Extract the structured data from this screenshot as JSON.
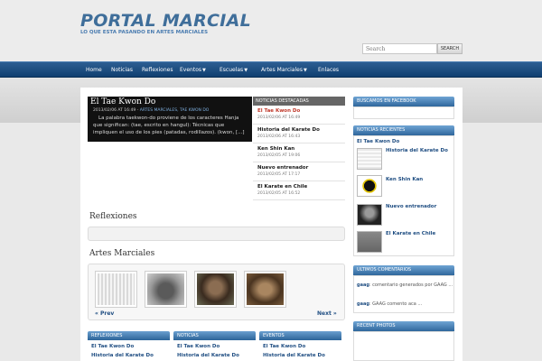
{
  "site": {
    "title": "PORTAL MARCIAL",
    "tagline": "LO QUE ESTA PASANDO EN ARTES MARCIALES"
  },
  "search": {
    "placeholder": "Search",
    "button_label": "SEARCH"
  },
  "nav": [
    {
      "label": "Home",
      "has_dropdown": false
    },
    {
      "label": "Noticias",
      "has_dropdown": false
    },
    {
      "label": "Reflexiones",
      "has_dropdown": false
    },
    {
      "label": "Eventos",
      "has_dropdown": true
    },
    {
      "label": "Escuelas",
      "has_dropdown": true
    },
    {
      "label": "Artes Marciales",
      "has_dropdown": true
    },
    {
      "label": "Enlaces",
      "has_dropdown": false
    }
  ],
  "featured": {
    "title": "El Tae Kwon Do",
    "date": "2013/02/06 AT 16:49",
    "categories": "ARTES MARCIALES, TAE KWON DO",
    "excerpt": "La palabra taekwon-do proviene de los caracteres Hanja que significan: (tae, escrito en hangul): Técnicas que impliquen el uso de los pies (patadas, rodillazos). (kwon, [...]"
  },
  "featured_list": {
    "header": "NOTICIAS DESTACADAS",
    "items": [
      {
        "title": "El Tae Kwon Do",
        "date": "2013/02/06 AT 16:49"
      },
      {
        "title": "Historia del Karate Do",
        "date": "2013/02/06 AT 16:43"
      },
      {
        "title": "Ken Shin Kan",
        "date": "2013/02/05 AT 19:06"
      },
      {
        "title": "Nuevo entrenador",
        "date": "2013/02/05 AT 17:17"
      },
      {
        "title": "El Karate en Chile",
        "date": "2013/02/05 AT 16:52"
      }
    ]
  },
  "sections": {
    "reflexiones": "Reflexiones",
    "artes_marciales": "Artes Marciales"
  },
  "carousel": {
    "prev": "« Prev",
    "next": "Next »"
  },
  "bottom_boxes": [
    {
      "header": "REFLEXIONES",
      "links": [
        "El Tae Kwon Do",
        "Historia del Karate Do"
      ]
    },
    {
      "header": "NOTICIAS",
      "links": [
        "El Tae Kwon Do",
        "Historia del Karate Do"
      ]
    },
    {
      "header": "EVENTOS",
      "links": [
        "El Tae Kwon Do",
        "Historia del Karate Do"
      ]
    }
  ],
  "sidebar": {
    "facebook_header": "BUSCAMOS EN FACEBOOK",
    "recent_header": "NOTICIAS RECIENTES",
    "recent_top": "El Tae Kwon Do",
    "recent_items": [
      "Historia del Karate Do",
      "Ken Shin Kan",
      "Nuevo entrenador",
      "El Karate en Chile"
    ],
    "comments_header": "ULTIMOS COMENTARIOS",
    "comments": [
      {
        "author": "gaag",
        "text": ": comentario generados por GAAG ..."
      },
      {
        "author": "gaag",
        "text": ": GAAG comento aca ..."
      }
    ],
    "photos_header": "RECENT PHOTOS"
  },
  "colors": {
    "accent": "#214f83",
    "nav": "#1c4c80",
    "title": "#3f6e9a",
    "active": "#c0392b"
  }
}
